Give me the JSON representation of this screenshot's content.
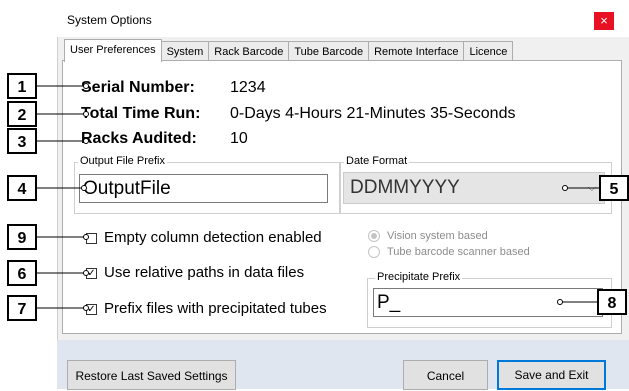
{
  "window": {
    "title": "System Options",
    "close_glyph": "×"
  },
  "tabs": [
    "User Preferences",
    "System",
    "Rack Barcode",
    "Tube Barcode",
    "Remote Interface",
    "Licence"
  ],
  "info": {
    "serial_label": "Serial Number:",
    "serial_value": "1234",
    "time_label": "Total Time Run:",
    "time_value": "0-Days 4-Hours 21-Minutes 35-Seconds",
    "racks_label": "Racks Audited:",
    "racks_value": "10"
  },
  "output_prefix": {
    "legend": "Output File Prefix",
    "value": "OutputFile"
  },
  "date_format": {
    "legend": "Date Format",
    "value": "DDMMYYYY"
  },
  "checkboxes": {
    "empty_column": {
      "label": "Empty column detection enabled",
      "checked": false
    },
    "relative_paths": {
      "label": "Use relative paths in data files",
      "checked": true
    },
    "prefix_precipitated": {
      "label": "Prefix files with precipitated tubes",
      "checked": true
    }
  },
  "detection_mode": {
    "options": [
      "Vision system based",
      "Tube barcode scanner based"
    ],
    "selected": "Vision system based"
  },
  "precipitate_prefix": {
    "legend": "Precipitate Prefix",
    "value": "P_"
  },
  "buttons": {
    "restore": "Restore Last Saved Settings",
    "cancel": "Cancel",
    "save_exit": "Save and Exit"
  },
  "callouts": [
    "1",
    "2",
    "3",
    "4",
    "5",
    "6",
    "7",
    "8",
    "9"
  ],
  "colors": {
    "close": "#e81123",
    "default_button_border": "#0078d7",
    "button_bar": "#dfe6f0"
  }
}
